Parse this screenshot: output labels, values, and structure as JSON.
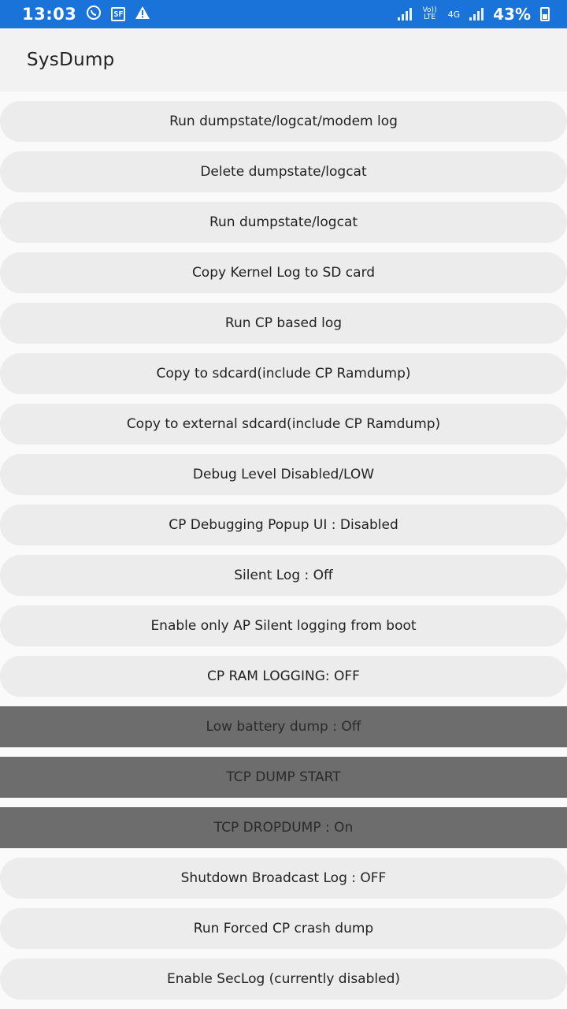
{
  "status_bar": {
    "time": "13:03",
    "icons": [
      "whatsapp-icon",
      "sf-badge-icon",
      "alert-icon"
    ],
    "sf_badge": "SF",
    "volte": "Vo)) LTE",
    "network": "4G",
    "battery_pct": "43%"
  },
  "app_bar": {
    "title": "SysDump"
  },
  "buttons": [
    {
      "label": "Run dumpstate/logcat/modem log"
    },
    {
      "label": "Delete dumpstate/logcat"
    },
    {
      "label": "Run dumpstate/logcat"
    },
    {
      "label": "Copy Kernel Log to SD card"
    },
    {
      "label": "Run CP based log"
    },
    {
      "label": "Copy to sdcard(include CP Ramdump)"
    },
    {
      "label": "Copy to external sdcard(include CP Ramdump)"
    },
    {
      "label": "Debug Level Disabled/LOW"
    },
    {
      "label": "CP Debugging Popup UI : Disabled"
    },
    {
      "label": "Silent Log : Off"
    },
    {
      "label": "Enable only AP Silent logging from boot"
    },
    {
      "label": "CP RAM LOGGING: OFF"
    },
    {
      "label": "Low battery dump : Off"
    },
    {
      "label": "TCP DUMP START"
    },
    {
      "label": "TCP DROPDUMP : On"
    },
    {
      "label": "Shutdown Broadcast Log : OFF"
    },
    {
      "label": "Run Forced CP crash dump"
    },
    {
      "label": "Enable SecLog (currently disabled)"
    }
  ],
  "colors": {
    "status_bar": "#1a73d9",
    "button_bg": "#ececec",
    "button_disabled_bg": "#6d6d6d"
  }
}
